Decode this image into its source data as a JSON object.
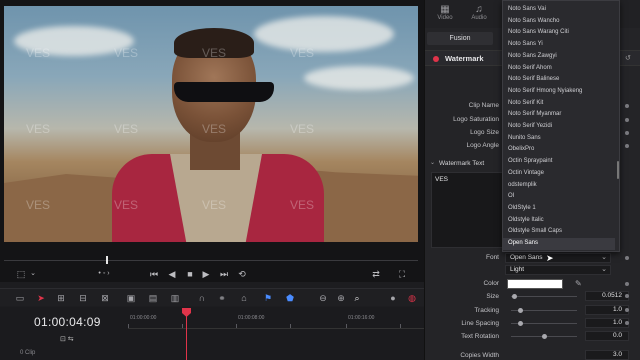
{
  "viewer": {
    "watermark_text": "VES",
    "timecode": "01:00:04:09",
    "clip_count": "0 Clip",
    "ruler_labels": [
      "01:00:00:00",
      "01:00:08:00",
      "01:00:16:00"
    ]
  },
  "inspector": {
    "tabs": [
      {
        "label": "Video",
        "icon": "film-icon"
      },
      {
        "label": "Audio",
        "icon": "music-note-icon"
      }
    ],
    "fusion_label": "Fusion",
    "effect_title": "Watermark",
    "params": {
      "clip_name": "Clip Name",
      "logo_saturation": "Logo Saturation",
      "logo_size": "Logo Size",
      "logo_angle": "Logo Angle"
    },
    "watermark_text_section": "Watermark Text",
    "watermark_text_value": "VES",
    "font_label": "Font",
    "font_value": "Open Sans",
    "style_value": "Light",
    "color_label": "Color",
    "color_value": "#ffffff",
    "size_label": "Size",
    "size_value": "0.0512",
    "size_level": 0.05,
    "tracking_label": "Tracking",
    "tracking_value": "1.0",
    "tracking_level": 0.14,
    "line_spacing_label": "Line Spacing",
    "line_spacing_value": "1.0",
    "line_spacing_level": 0.14,
    "text_rotation_label": "Text Rotation",
    "text_rotation_value": "0.0",
    "text_rotation_level": 0.5,
    "copies_width_label": "Copies Width",
    "copies_width_value": "3.0"
  },
  "font_menu": {
    "items": [
      "Noto Sans Vai",
      "Noto Sans Wancho",
      "Noto Sans Warang Citi",
      "Noto Sans Yi",
      "Noto Sans Zawgyi",
      "Noto Serif Ahom",
      "Noto Serif Balinese",
      "Noto Serif Hmong Nyiakeng",
      "Noto Serif Kit",
      "Noto Serif Myanmar",
      "Noto Serif Yezidi",
      "Nunito Sans",
      "ObelixPro",
      "Octin Spraypaint",
      "Octin Vintage",
      "odstemplik",
      "OI",
      "OldStyle 1",
      "Oldstyle Italic",
      "Oldstyle Small Caps",
      "Open Sans"
    ],
    "selected": "Open Sans"
  },
  "accent_color": "#e0344a"
}
